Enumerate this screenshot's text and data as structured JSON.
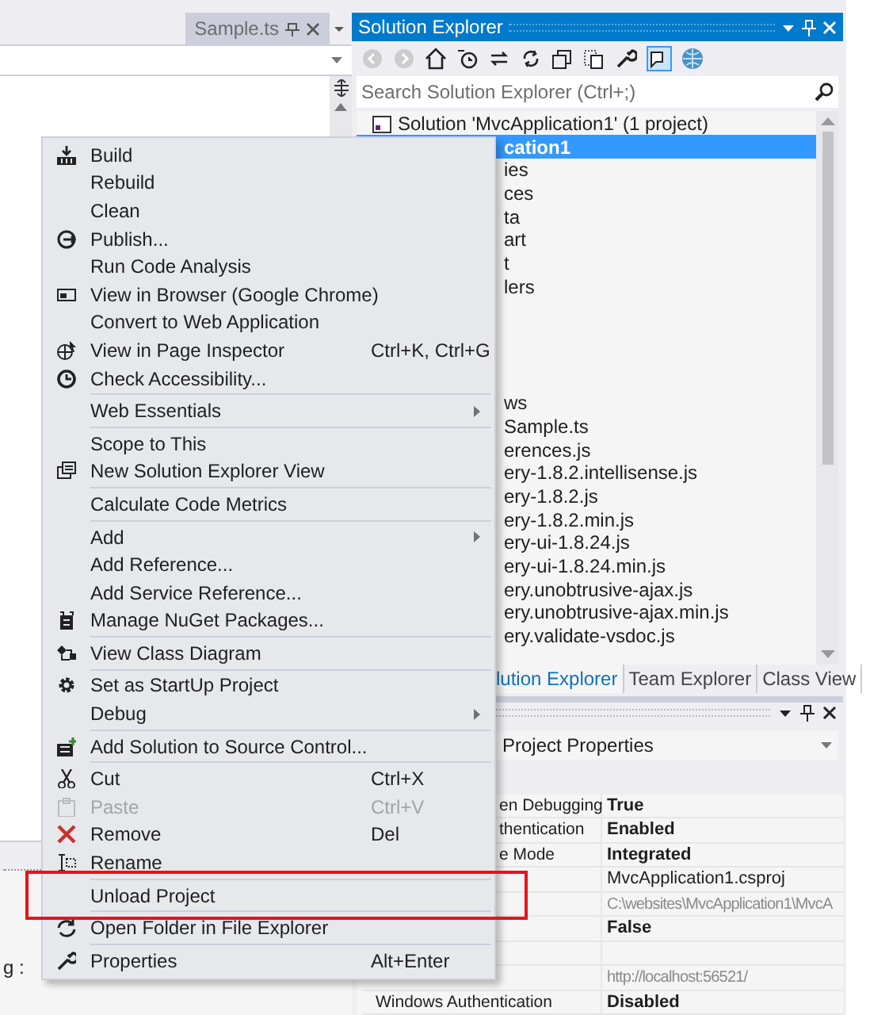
{
  "editor": {
    "tab": {
      "title": "Sample.ts"
    },
    "output_fragment": "g :"
  },
  "solution_explorer": {
    "title": "Solution Explorer",
    "search": {
      "placeholder": "Search Solution Explorer (Ctrl+;)"
    },
    "tree": [
      {
        "kind": "solution",
        "label": "Solution 'MvcApplication1' (1 project)",
        "selected": false
      },
      {
        "kind": "fragment",
        "label": "cation1",
        "selected": true
      },
      {
        "kind": "fragment",
        "label": "ies",
        "selected": false
      },
      {
        "kind": "fragment",
        "label": "ces",
        "selected": false
      },
      {
        "kind": "fragment",
        "label": "ta",
        "selected": false
      },
      {
        "kind": "fragment",
        "label": "art",
        "selected": false
      },
      {
        "kind": "fragment",
        "label": "t",
        "selected": false
      },
      {
        "kind": "fragment",
        "label": "lers",
        "selected": false
      },
      {
        "kind": "blank"
      },
      {
        "kind": "blank"
      },
      {
        "kind": "blank"
      },
      {
        "kind": "blank"
      },
      {
        "kind": "fragment",
        "label": "ws",
        "selected": false
      },
      {
        "kind": "fragment",
        "label": "Sample.ts",
        "selected": false
      },
      {
        "kind": "fragment",
        "label": "erences.js",
        "selected": false
      },
      {
        "kind": "fragment",
        "label": "ery-1.8.2.intellisense.js",
        "selected": false
      },
      {
        "kind": "fragment",
        "label": "ery-1.8.2.js",
        "selected": false
      },
      {
        "kind": "fragment",
        "label": "ery-1.8.2.min.js",
        "selected": false
      },
      {
        "kind": "fragment",
        "label": "ery-ui-1.8.24.js",
        "selected": false
      },
      {
        "kind": "fragment",
        "label": "ery-ui-1.8.24.min.js",
        "selected": false
      },
      {
        "kind": "fragment",
        "label": "ery.unobtrusive-ajax.js",
        "selected": false
      },
      {
        "kind": "fragment",
        "label": "ery.unobtrusive-ajax.min.js",
        "selected": false
      },
      {
        "kind": "fragment",
        "label": "ery.validate-vsdoc.js",
        "selected": false
      }
    ],
    "tabs": [
      {
        "label": "lution Explorer",
        "selected": true
      },
      {
        "label": "Team Explorer",
        "selected": false
      },
      {
        "label": "Class View",
        "selected": false
      }
    ]
  },
  "properties": {
    "dropdown": "Project Properties",
    "rows": [
      {
        "kind": "fragment",
        "name": "en Debugging",
        "value": "True",
        "modified": true,
        "read_only": false
      },
      {
        "kind": "fragment",
        "name": "thentication",
        "value": "Enabled",
        "modified": true,
        "read_only": false
      },
      {
        "kind": "fragment",
        "name": "e Mode",
        "value": "Integrated",
        "modified": true,
        "read_only": false
      },
      {
        "kind": "fragment",
        "value": "MvcApplication1.csproj",
        "modified": false,
        "read_only": false
      },
      {
        "kind": "fragment",
        "value": "C:\\websites\\MvcApplication1\\MvcA",
        "modified": false,
        "read_only": true
      },
      {
        "kind": "fragment",
        "value": "False",
        "modified": true,
        "read_only": false
      },
      {
        "kind": "fragment"
      },
      {
        "kind": "fragment",
        "value": "http://localhost:56521/",
        "modified": false,
        "read_only": true
      },
      {
        "kind": "full",
        "name": "Windows Authentication",
        "value": "Disabled",
        "modified": true,
        "read_only": false
      }
    ]
  },
  "context_menu": {
    "items": [
      {
        "kind": "item",
        "label": "Build"
      },
      {
        "kind": "item",
        "label": "Rebuild"
      },
      {
        "kind": "item",
        "label": "Clean"
      },
      {
        "kind": "item",
        "label": "Publish..."
      },
      {
        "kind": "item",
        "label": "Run Code Analysis"
      },
      {
        "kind": "item",
        "label": "View in Browser (Google Chrome)"
      },
      {
        "kind": "item",
        "label": "Convert to Web Application"
      },
      {
        "kind": "item",
        "label": "View in Page Inspector",
        "shortcut": "Ctrl+K, Ctrl+G"
      },
      {
        "kind": "item",
        "label": "Check Accessibility..."
      },
      {
        "kind": "separator"
      },
      {
        "kind": "item",
        "label": "Web Essentials",
        "submenu": true
      },
      {
        "kind": "separator"
      },
      {
        "kind": "item",
        "label": "Scope to This"
      },
      {
        "kind": "item",
        "label": "New Solution Explorer View"
      },
      {
        "kind": "separator"
      },
      {
        "kind": "item",
        "label": "Calculate Code Metrics"
      },
      {
        "kind": "separator"
      },
      {
        "kind": "item",
        "label": "Add",
        "submenu": true
      },
      {
        "kind": "item",
        "label": "Add Reference..."
      },
      {
        "kind": "item",
        "label": "Add Service Reference..."
      },
      {
        "kind": "item",
        "label": "Manage NuGet Packages..."
      },
      {
        "kind": "separator"
      },
      {
        "kind": "item",
        "label": "View Class Diagram"
      },
      {
        "kind": "separator"
      },
      {
        "kind": "item",
        "label": "Set as StartUp Project"
      },
      {
        "kind": "item",
        "label": "Debug",
        "submenu": true
      },
      {
        "kind": "separator"
      },
      {
        "kind": "item",
        "label": "Add Solution to Source Control..."
      },
      {
        "kind": "separator"
      },
      {
        "kind": "item",
        "label": "Cut",
        "shortcut": "Ctrl+X"
      },
      {
        "kind": "item",
        "label": "Paste",
        "shortcut": "Ctrl+V",
        "disabled": true
      },
      {
        "kind": "item",
        "label": "Remove",
        "shortcut": "Del"
      },
      {
        "kind": "item",
        "label": "Rename"
      },
      {
        "kind": "separator"
      },
      {
        "kind": "item",
        "label": "Unload Project",
        "highlighted": true
      },
      {
        "kind": "separator"
      },
      {
        "kind": "item",
        "label": "Open Folder in File Explorer"
      },
      {
        "kind": "separator"
      },
      {
        "kind": "item",
        "label": "Properties",
        "shortcut": "Alt+Enter"
      }
    ]
  }
}
